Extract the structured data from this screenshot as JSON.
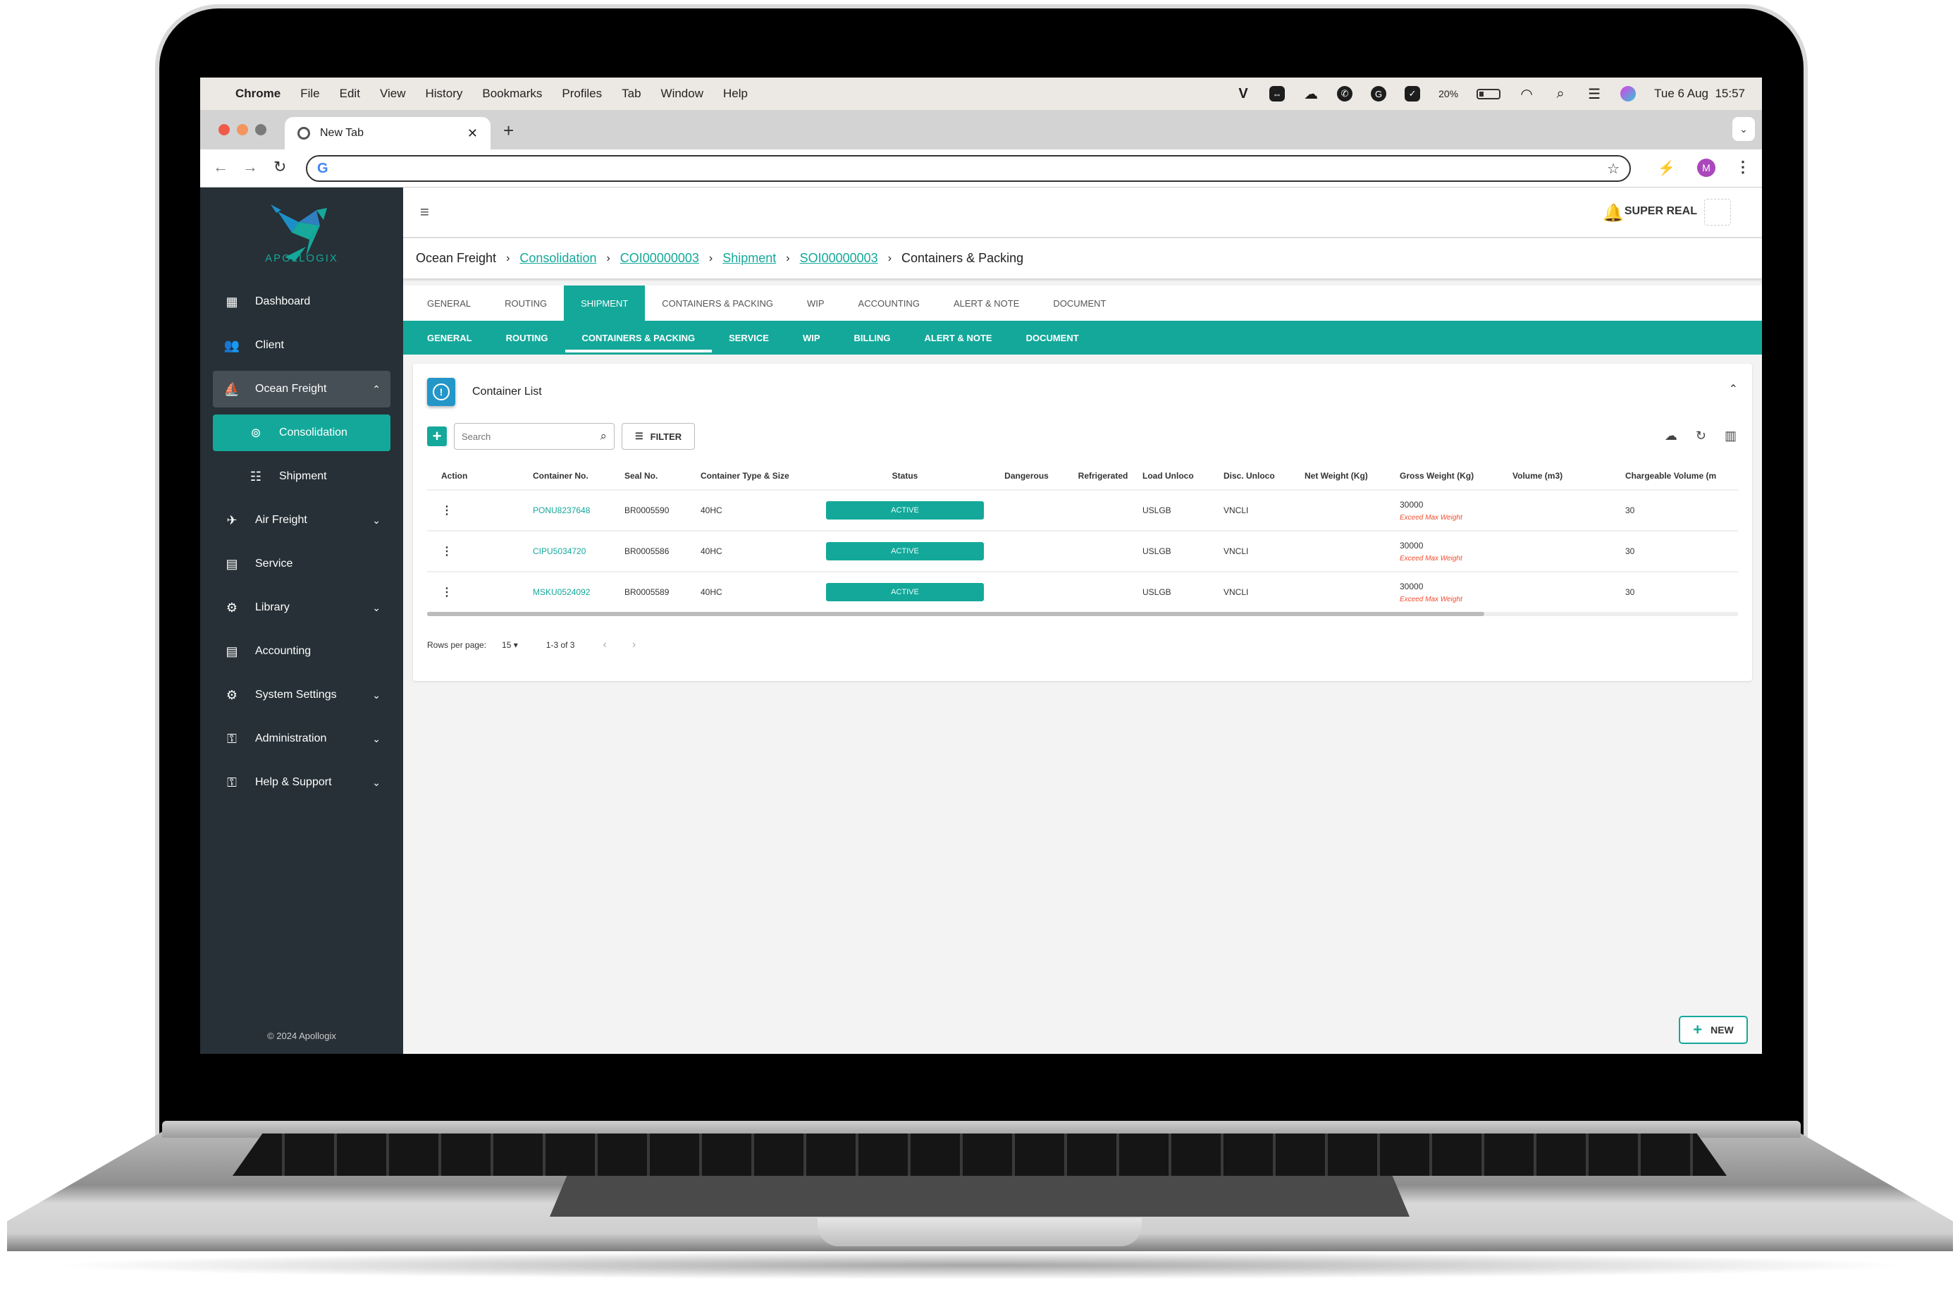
{
  "macos": {
    "menu": [
      "Chrome",
      "File",
      "Edit",
      "View",
      "History",
      "Bookmarks",
      "Profiles",
      "Tab",
      "Window",
      "Help"
    ],
    "status_icons": [
      "v-icon",
      "teamviewer-icon",
      "creative-cloud-icon",
      "phone-notify-icon",
      "grammarly-icon",
      "check-icon",
      "battery-icon",
      "wifi-icon",
      "spotlight-search-icon",
      "control-center-icon",
      "siri-icon"
    ],
    "battery": "20%",
    "datetime": "Tue 6 Aug  15:57"
  },
  "browser": {
    "tab_title": "New Tab",
    "address_value": "",
    "profile_initial": "M"
  },
  "app": {
    "brand": "APOLLOGIX",
    "footer": "© 2024 Apollogix",
    "user_name": "SUPER REAL",
    "sidebar": [
      {
        "label": "Dashboard",
        "icon": "dashboard-icon",
        "glyph": "▦",
        "chevron": ""
      },
      {
        "label": "Client",
        "icon": "people-icon",
        "glyph": "👥",
        "chevron": ""
      },
      {
        "label": "Ocean Freight",
        "icon": "ship-icon",
        "glyph": "⛵",
        "chevron": "⌃",
        "expanded": true
      },
      {
        "label": "Consolidation",
        "icon": "consolidation-icon",
        "glyph": "⊚",
        "chevron": "",
        "active": true,
        "sub": true
      },
      {
        "label": "Shipment",
        "icon": "list-icon",
        "glyph": "☷",
        "chevron": "",
        "sub": true
      },
      {
        "label": "Air Freight",
        "icon": "airplane-icon",
        "glyph": "✈",
        "chevron": "⌄"
      },
      {
        "label": "Service",
        "icon": "document-icon",
        "glyph": "▤",
        "chevron": ""
      },
      {
        "label": "Library",
        "icon": "gears-icon",
        "glyph": "⚙",
        "chevron": "⌄"
      },
      {
        "label": "Accounting",
        "icon": "document-icon",
        "glyph": "▤",
        "chevron": ""
      },
      {
        "label": "System Settings",
        "icon": "gear-icon",
        "glyph": "⚙",
        "chevron": "⌄"
      },
      {
        "label": "Administration",
        "icon": "key-icon",
        "glyph": "⚿",
        "chevron": "⌄"
      },
      {
        "label": "Help & Support",
        "icon": "key-icon",
        "glyph": "⚿",
        "chevron": "⌄"
      }
    ],
    "breadcrumb": [
      {
        "label": "Ocean Freight",
        "link": false
      },
      {
        "label": "Consolidation",
        "link": true
      },
      {
        "label": "COI00000003",
        "link": true
      },
      {
        "label": "Shipment",
        "link": true
      },
      {
        "label": "SOI00000003",
        "link": true
      },
      {
        "label": "Containers & Packing",
        "link": false
      }
    ],
    "tabs_primary": [
      "GENERAL",
      "ROUTING",
      "SHIPMENT",
      "CONTAINERS & PACKING",
      "WIP",
      "ACCOUNTING",
      "ALERT & NOTE",
      "DOCUMENT"
    ],
    "tabs_primary_active": "SHIPMENT",
    "tabs_secondary": [
      "GENERAL",
      "ROUTING",
      "CONTAINERS & PACKING",
      "SERVICE",
      "WIP",
      "BILLING",
      "ALERT & NOTE",
      "DOCUMENT"
    ],
    "tabs_secondary_active": "CONTAINERS & PACKING",
    "card": {
      "title": "Container List",
      "search_placeholder": "Search",
      "filter_label": "FILTER",
      "columns": [
        "Action",
        "Container No.",
        "Seal No.",
        "Container Type & Size",
        "Status",
        "Dangerous",
        "Refrigerated",
        "Load Unloco",
        "Disc. Unloco",
        "Net Weight (Kg)",
        "Gross Weight (Kg)",
        "Volume (m3)",
        "Chargeable Volume (m"
      ],
      "rows": [
        {
          "container_no": "PONU8237648",
          "seal_no": "BR0005590",
          "type_size": "40HC",
          "status": "ACTIVE",
          "dangerous": "",
          "refrigerated": "",
          "load_unloco": "USLGB",
          "disc_unloco": "VNCLI",
          "net_weight": "",
          "gross_weight": "30000",
          "gross_warning": "Exceed Max Weight",
          "volume": "",
          "chargeable_volume": "30"
        },
        {
          "container_no": "CIPU5034720",
          "seal_no": "BR0005586",
          "type_size": "40HC",
          "status": "ACTIVE",
          "dangerous": "",
          "refrigerated": "",
          "load_unloco": "USLGB",
          "disc_unloco": "VNCLI",
          "net_weight": "",
          "gross_weight": "30000",
          "gross_warning": "Exceed Max Weight",
          "volume": "",
          "chargeable_volume": "30"
        },
        {
          "container_no": "MSKU0524092",
          "seal_no": "BR0005589",
          "type_size": "40HC",
          "status": "ACTIVE",
          "dangerous": "",
          "refrigerated": "",
          "load_unloco": "USLGB",
          "disc_unloco": "VNCLI",
          "net_weight": "",
          "gross_weight": "30000",
          "gross_warning": "Exceed Max Weight",
          "volume": "",
          "chargeable_volume": "30"
        }
      ],
      "pagination": {
        "rows_per_page_label": "Rows per page:",
        "rows_per_page": "15",
        "range": "1-3 of 3"
      }
    },
    "new_button": "NEW",
    "colors": {
      "accent": "#14a89a",
      "sidebar_bg": "#263036",
      "info_icon": "#2496c8",
      "warning": "#f04e30"
    }
  }
}
